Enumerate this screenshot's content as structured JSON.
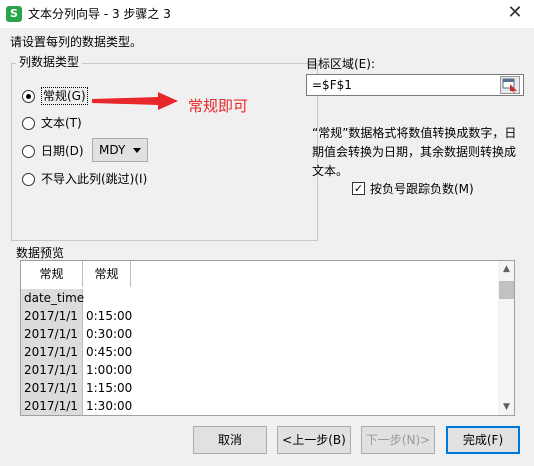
{
  "window": {
    "title": "文本分列向导 - 3 步骤之 3",
    "app_icon": "S",
    "close_glyph": "✕"
  },
  "instruction": "请设置每列的数据类型。",
  "column_type_group": {
    "legend": "列数据类型",
    "options": [
      {
        "label": "常规(G)",
        "checked": true
      },
      {
        "label": "文本(T)",
        "checked": false
      },
      {
        "label": "日期(D)",
        "checked": false
      },
      {
        "label": "不导入此列(跳过)(I)",
        "checked": false
      }
    ],
    "date_format": "MDY"
  },
  "annotation": {
    "text": "常规即可",
    "color": "#e8272c"
  },
  "destination": {
    "label": "目标区域(E):",
    "value": "=$F$1"
  },
  "description": "“常规”数据格式将数值转换成数字，日期值会转换为日期，其余数据则转换成文本。",
  "negative_checkbox": {
    "label": "按负号跟踪负数(M)",
    "checked": true
  },
  "preview": {
    "label": "数据预览",
    "headers": [
      "常规",
      "常规"
    ],
    "rows": [
      [
        "date_time",
        ""
      ],
      [
        "2017/1/1",
        "0:15:00"
      ],
      [
        "2017/1/1",
        "0:30:00"
      ],
      [
        "2017/1/1",
        "0:45:00"
      ],
      [
        "2017/1/1",
        "1:00:00"
      ],
      [
        "2017/1/1",
        "1:15:00"
      ],
      [
        "2017/1/1",
        "1:30:00"
      ]
    ]
  },
  "buttons": {
    "cancel": "取消",
    "back": "<上一步(B)",
    "next": "下一步(N)>",
    "finish": "完成(F)"
  },
  "colors": {
    "background": "#f0f0f0",
    "accent": "#0078d7",
    "app_icon": "#2aa44a"
  }
}
